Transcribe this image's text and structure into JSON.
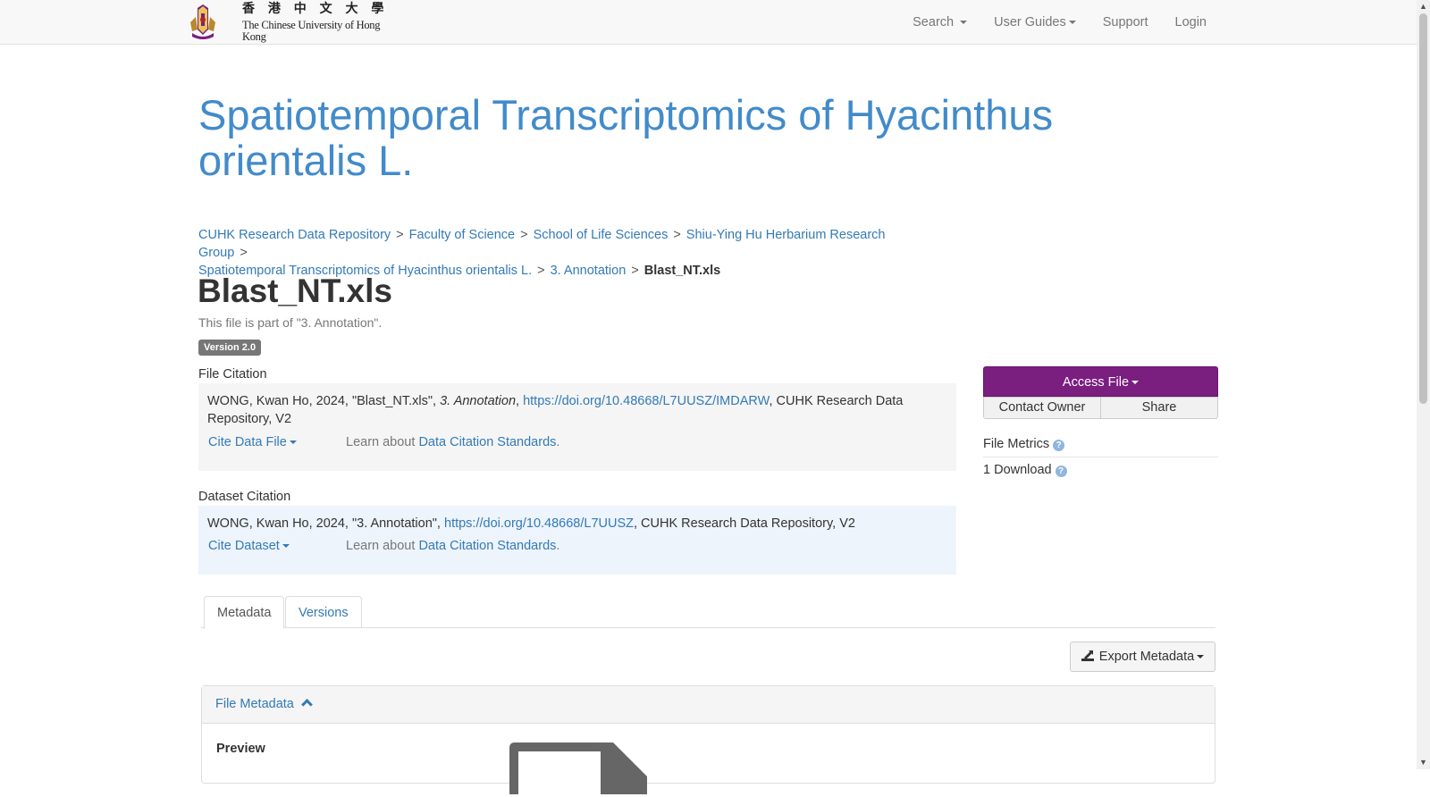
{
  "header": {
    "logo_cn": "香 港 中 文 大 學",
    "logo_en": "The Chinese University of Hong Kong",
    "nav": {
      "search": "Search",
      "user_guides": "User Guides",
      "support": "Support",
      "login": "Login"
    }
  },
  "dataset_title": "Spatiotemporal Transcriptomics of Hyacinthus orientalis L.",
  "breadcrumb": {
    "items": [
      "CUHK Research Data Repository",
      "Faculty of Science",
      "School of Life Sciences",
      "Shiu-Ying Hu Herbarium Research Group",
      "Spatiotemporal Transcriptomics of Hyacinthus orientalis L.",
      "3. Annotation"
    ],
    "current": "Blast_NT.xls",
    "separator": ">"
  },
  "file": {
    "title": "Blast_NT.xls",
    "part_of": "This file is part of \"3. Annotation\".",
    "version": "Version 2.0"
  },
  "file_citation": {
    "label": "File Citation",
    "prefix": "WONG, Kwan Ho, 2024, \"Blast_NT.xls\", ",
    "italic": "3. Annotation",
    "comma": ", ",
    "doi": "https://doi.org/10.48668/L7UUSZ/IMDARW",
    "suffix": ", CUHK Research Data Repository, V2",
    "cite_button": "Cite Data File",
    "learn_prefix": "Learn about ",
    "learn_link": "Data Citation Standards",
    "learn_suffix": "."
  },
  "dataset_citation": {
    "label": "Dataset Citation",
    "prefix": "WONG, Kwan Ho, 2024, \"3. Annotation\", ",
    "doi": "https://doi.org/10.48668/L7UUSZ",
    "suffix": ", CUHK Research Data Repository, V2",
    "cite_button": "Cite Dataset",
    "learn_prefix": "Learn about ",
    "learn_link": "Data Citation Standards",
    "learn_suffix": "."
  },
  "sidebar": {
    "access_file": "Access File",
    "contact_owner": "Contact Owner",
    "share": "Share",
    "metrics_title": "File Metrics",
    "downloads": "1 Download"
  },
  "tabs": {
    "metadata": "Metadata",
    "versions": "Versions"
  },
  "export_metadata": "Export Metadata",
  "panel": {
    "title": "File Metadata",
    "preview_label": "Preview"
  },
  "colors": {
    "link": "#337ab7",
    "title": "#428bca",
    "access_button": "#7a1e80",
    "dataset_citation_bg": "#edf4fb",
    "file_citation_bg": "#f5f5f5"
  }
}
